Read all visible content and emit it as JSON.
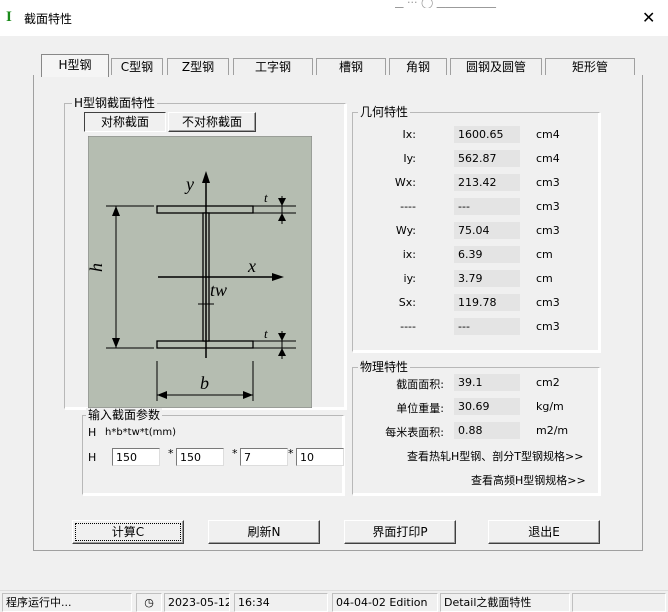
{
  "window": {
    "title": "截面特性",
    "app_logo": "I"
  },
  "tabs": [
    "H型钢",
    "C型钢",
    "Z型钢",
    "工字钢",
    "槽钢",
    "角钢",
    "圆钢及圆管",
    "矩形管"
  ],
  "section": {
    "group_label": "H型钢截面特性",
    "sym_button": "对称截面",
    "asym_button": "不对称截面",
    "diagram": {
      "y": "y",
      "x": "x",
      "t": "t",
      "h": "h",
      "tw": "tw",
      "b": "b"
    }
  },
  "input": {
    "group_label": "输入截面参数",
    "formula_prefix": "H",
    "formula": "h*b*tw*t(mm)",
    "row_label": "H",
    "values": [
      "150",
      "150",
      "7",
      "10"
    ],
    "separator": "*"
  },
  "geometry": {
    "group_label": "几何特性",
    "rows": [
      {
        "label": "Ix:",
        "value": "1600.65",
        "unit": "cm4"
      },
      {
        "label": "Iy:",
        "value": "562.87",
        "unit": "cm4"
      },
      {
        "label": "Wx:",
        "value": "213.42",
        "unit": "cm3"
      },
      {
        "label": "----",
        "value": "---",
        "unit": "cm3"
      },
      {
        "label": "Wy:",
        "value": "75.04",
        "unit": "cm3"
      },
      {
        "label": "ix:",
        "value": "6.39",
        "unit": "cm"
      },
      {
        "label": "iy:",
        "value": "3.79",
        "unit": "cm"
      },
      {
        "label": "Sx:",
        "value": "119.78",
        "unit": "cm3"
      },
      {
        "label": "----",
        "value": "---",
        "unit": "cm3"
      }
    ]
  },
  "physical": {
    "group_label": "物理特性",
    "rows": [
      {
        "label": "截面面积:",
        "value": "39.1",
        "unit": "cm2"
      },
      {
        "label": "单位重量:",
        "value": "30.69",
        "unit": "kg/m"
      },
      {
        "label": "每米表面积:",
        "value": "0.88",
        "unit": "m2/m"
      }
    ],
    "link_hot": "查看热轧H型钢、剖分T型钢规格>>",
    "link_hf": "查看高频H型钢规格>>"
  },
  "buttons": {
    "calc": "计算C",
    "refresh": "刷新N",
    "print": "界面打印P",
    "exit": "退出E"
  },
  "status": {
    "running": "程序运行中...",
    "date": "2023-05-12",
    "time": "16:34",
    "edition": "04-04-02 Edition",
    "page": "Detail之截面特性"
  }
}
